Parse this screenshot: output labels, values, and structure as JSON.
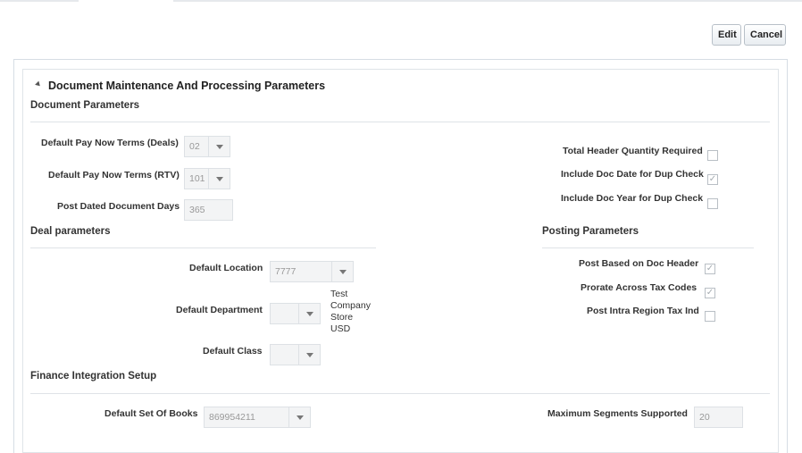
{
  "toolbar": {
    "edit_label": "Edit",
    "cancel_label": "Cancel"
  },
  "panel": {
    "title": "Document Maintenance And Processing Parameters"
  },
  "document_parameters": {
    "header": "Document Parameters",
    "pay_now_deals_label": "Default Pay Now Terms (Deals)",
    "pay_now_deals_value": "02",
    "pay_now_rtv_label": "Default Pay Now Terms (RTV)",
    "pay_now_rtv_value": "101",
    "post_dated_label": "Post Dated Document Days",
    "post_dated_value": "365",
    "total_header_qty_label": "Total Header Quantity Required",
    "total_header_qty_checked": false,
    "include_doc_date_label": "Include Doc Date for Dup Check",
    "include_doc_date_checked": true,
    "include_doc_year_label": "Include Doc Year for Dup Check",
    "include_doc_year_checked": false
  },
  "deal_parameters": {
    "header": "Deal parameters",
    "default_location_label": "Default Location",
    "default_location_value": "7777",
    "default_department_label": "Default Department",
    "default_department_value": "",
    "default_department_desc": [
      "Test",
      "Company",
      "Store",
      "USD"
    ],
    "default_class_label": "Default Class",
    "default_class_value": ""
  },
  "posting_parameters": {
    "header": "Posting Parameters",
    "post_based_label": "Post Based on Doc Header",
    "post_based_checked": true,
    "prorate_label": "Prorate Across Tax Codes",
    "prorate_checked": true,
    "intra_region_label": "Post Intra Region Tax Ind",
    "intra_region_checked": false
  },
  "finance_integration": {
    "header": "Finance Integration Setup",
    "set_of_books_label": "Default Set Of Books",
    "set_of_books_value": "869954211",
    "max_segments_label": "Maximum Segments Supported",
    "max_segments_value": "20"
  },
  "glyphs": {
    "check": "✓"
  }
}
